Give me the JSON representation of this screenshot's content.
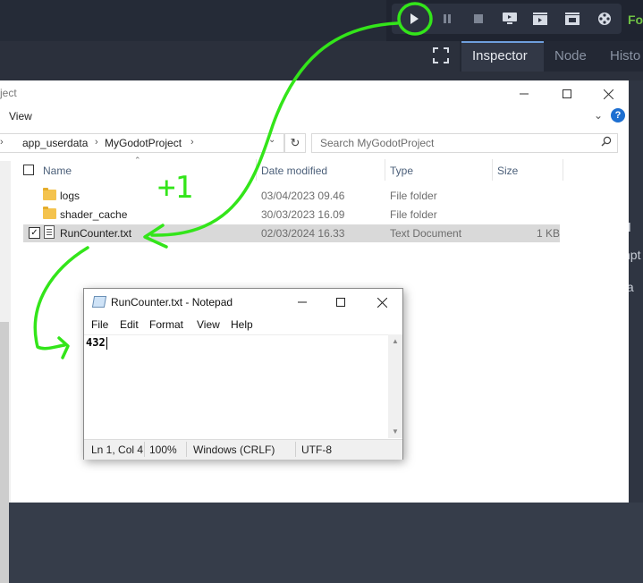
{
  "godot": {
    "toolbar_buttons": [
      "play-icon",
      "pause-icon",
      "stop-icon",
      "remote-debug-icon",
      "play-scene-icon",
      "play-custom-scene-icon",
      "movie-maker-icon"
    ],
    "renderer_label": "Fo",
    "dock_tabs": [
      {
        "label": "Inspector",
        "active": true
      },
      {
        "label": "Node",
        "active": false
      },
      {
        "label": "Histo",
        "active": false
      }
    ],
    "right_panel_fragments": [
      "d",
      "npt",
      "ta"
    ],
    "accent_color": "#6fc244"
  },
  "explorer": {
    "title": "ject",
    "ribbon_view": "View",
    "address": {
      "segments": [
        "app_userdata",
        "MyGodotProject"
      ]
    },
    "search_placeholder": "Search MyGodotProject",
    "columns": {
      "name": "Name",
      "date": "Date modified",
      "type": "Type",
      "size": "Size"
    },
    "files": [
      {
        "name": "logs",
        "date": "03/04/2023 09.46",
        "type": "File folder",
        "size": "",
        "icon": "folder-icon",
        "selected": false
      },
      {
        "name": "shader_cache",
        "date": "30/03/2023 16.09",
        "type": "File folder",
        "size": "",
        "icon": "folder-icon",
        "selected": false
      },
      {
        "name": "RunCounter.txt",
        "date": "02/03/2024 16.33",
        "type": "Text Document",
        "size": "1 KB",
        "icon": "text-file-icon",
        "selected": true
      }
    ]
  },
  "notepad": {
    "title": "RunCounter.txt - Notepad",
    "menu": [
      "File",
      "Edit",
      "Format",
      "View",
      "Help"
    ],
    "content": "432",
    "status": {
      "position": "Ln 1, Col 4",
      "zoom": "100%",
      "line_endings": "Windows (CRLF)",
      "encoding": "UTF-8"
    }
  },
  "annotation": {
    "label": "+1",
    "color": "#33e51a"
  }
}
